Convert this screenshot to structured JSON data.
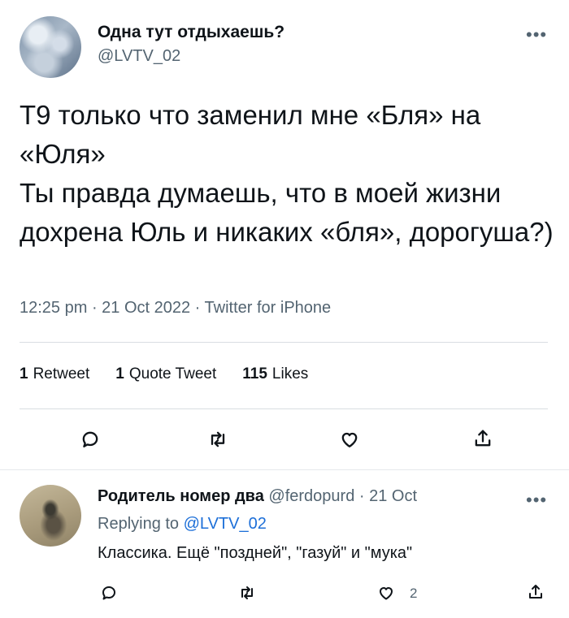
{
  "tweet": {
    "author_name": "Одна тут отдыхаешь?",
    "author_handle": "@LVTV_02",
    "more_label": "•••",
    "text": "Т9 только что заменил мне «Бля» на «Юля»\nТы правда думаешь, что в моей жизни дохрена Юль и никаких «бля», дорогуша?)",
    "meta": "12:25 pm · 21 Oct 2022 · Twitter for iPhone",
    "stats": {
      "retweets_count": "1",
      "retweets_label": "Retweet",
      "quotes_count": "1",
      "quotes_label": "Quote Tweet",
      "likes_count": "115",
      "likes_label": "Likes"
    },
    "icons": [
      "reply-icon",
      "retweet-icon",
      "like-icon",
      "share-icon"
    ]
  },
  "reply": {
    "author_name": "Родитель номер два",
    "author_handle": "@ferdopurd",
    "date": "· 21 Oct",
    "more_label": "•••",
    "replying_prefix": "Replying to",
    "replying_to": "@LVTV_02",
    "text": "Классика. Ещё \"поздней\", \"газуй\" и \"мука\"",
    "like_count": "2"
  }
}
